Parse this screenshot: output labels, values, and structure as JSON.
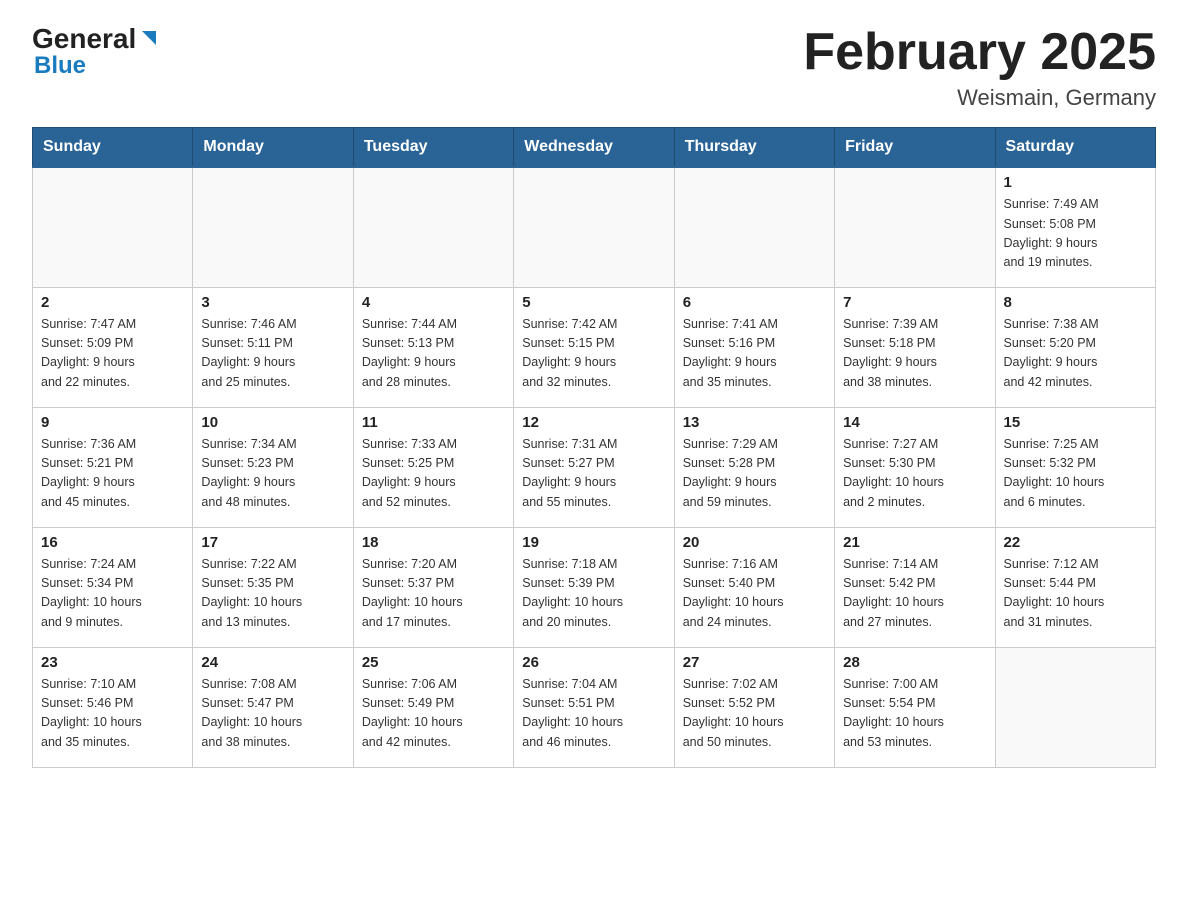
{
  "logo": {
    "text_general": "General",
    "text_blue": "Blue",
    "triangle_char": "▶"
  },
  "title": "February 2025",
  "subtitle": "Weismain, Germany",
  "weekdays": [
    "Sunday",
    "Monday",
    "Tuesday",
    "Wednesday",
    "Thursday",
    "Friday",
    "Saturday"
  ],
  "weeks": [
    [
      {
        "day": "",
        "info": ""
      },
      {
        "day": "",
        "info": ""
      },
      {
        "day": "",
        "info": ""
      },
      {
        "day": "",
        "info": ""
      },
      {
        "day": "",
        "info": ""
      },
      {
        "day": "",
        "info": ""
      },
      {
        "day": "1",
        "info": "Sunrise: 7:49 AM\nSunset: 5:08 PM\nDaylight: 9 hours\nand 19 minutes."
      }
    ],
    [
      {
        "day": "2",
        "info": "Sunrise: 7:47 AM\nSunset: 5:09 PM\nDaylight: 9 hours\nand 22 minutes."
      },
      {
        "day": "3",
        "info": "Sunrise: 7:46 AM\nSunset: 5:11 PM\nDaylight: 9 hours\nand 25 minutes."
      },
      {
        "day": "4",
        "info": "Sunrise: 7:44 AM\nSunset: 5:13 PM\nDaylight: 9 hours\nand 28 minutes."
      },
      {
        "day": "5",
        "info": "Sunrise: 7:42 AM\nSunset: 5:15 PM\nDaylight: 9 hours\nand 32 minutes."
      },
      {
        "day": "6",
        "info": "Sunrise: 7:41 AM\nSunset: 5:16 PM\nDaylight: 9 hours\nand 35 minutes."
      },
      {
        "day": "7",
        "info": "Sunrise: 7:39 AM\nSunset: 5:18 PM\nDaylight: 9 hours\nand 38 minutes."
      },
      {
        "day": "8",
        "info": "Sunrise: 7:38 AM\nSunset: 5:20 PM\nDaylight: 9 hours\nand 42 minutes."
      }
    ],
    [
      {
        "day": "9",
        "info": "Sunrise: 7:36 AM\nSunset: 5:21 PM\nDaylight: 9 hours\nand 45 minutes."
      },
      {
        "day": "10",
        "info": "Sunrise: 7:34 AM\nSunset: 5:23 PM\nDaylight: 9 hours\nand 48 minutes."
      },
      {
        "day": "11",
        "info": "Sunrise: 7:33 AM\nSunset: 5:25 PM\nDaylight: 9 hours\nand 52 minutes."
      },
      {
        "day": "12",
        "info": "Sunrise: 7:31 AM\nSunset: 5:27 PM\nDaylight: 9 hours\nand 55 minutes."
      },
      {
        "day": "13",
        "info": "Sunrise: 7:29 AM\nSunset: 5:28 PM\nDaylight: 9 hours\nand 59 minutes."
      },
      {
        "day": "14",
        "info": "Sunrise: 7:27 AM\nSunset: 5:30 PM\nDaylight: 10 hours\nand 2 minutes."
      },
      {
        "day": "15",
        "info": "Sunrise: 7:25 AM\nSunset: 5:32 PM\nDaylight: 10 hours\nand 6 minutes."
      }
    ],
    [
      {
        "day": "16",
        "info": "Sunrise: 7:24 AM\nSunset: 5:34 PM\nDaylight: 10 hours\nand 9 minutes."
      },
      {
        "day": "17",
        "info": "Sunrise: 7:22 AM\nSunset: 5:35 PM\nDaylight: 10 hours\nand 13 minutes."
      },
      {
        "day": "18",
        "info": "Sunrise: 7:20 AM\nSunset: 5:37 PM\nDaylight: 10 hours\nand 17 minutes."
      },
      {
        "day": "19",
        "info": "Sunrise: 7:18 AM\nSunset: 5:39 PM\nDaylight: 10 hours\nand 20 minutes."
      },
      {
        "day": "20",
        "info": "Sunrise: 7:16 AM\nSunset: 5:40 PM\nDaylight: 10 hours\nand 24 minutes."
      },
      {
        "day": "21",
        "info": "Sunrise: 7:14 AM\nSunset: 5:42 PM\nDaylight: 10 hours\nand 27 minutes."
      },
      {
        "day": "22",
        "info": "Sunrise: 7:12 AM\nSunset: 5:44 PM\nDaylight: 10 hours\nand 31 minutes."
      }
    ],
    [
      {
        "day": "23",
        "info": "Sunrise: 7:10 AM\nSunset: 5:46 PM\nDaylight: 10 hours\nand 35 minutes."
      },
      {
        "day": "24",
        "info": "Sunrise: 7:08 AM\nSunset: 5:47 PM\nDaylight: 10 hours\nand 38 minutes."
      },
      {
        "day": "25",
        "info": "Sunrise: 7:06 AM\nSunset: 5:49 PM\nDaylight: 10 hours\nand 42 minutes."
      },
      {
        "day": "26",
        "info": "Sunrise: 7:04 AM\nSunset: 5:51 PM\nDaylight: 10 hours\nand 46 minutes."
      },
      {
        "day": "27",
        "info": "Sunrise: 7:02 AM\nSunset: 5:52 PM\nDaylight: 10 hours\nand 50 minutes."
      },
      {
        "day": "28",
        "info": "Sunrise: 7:00 AM\nSunset: 5:54 PM\nDaylight: 10 hours\nand 53 minutes."
      },
      {
        "day": "",
        "info": ""
      }
    ]
  ]
}
